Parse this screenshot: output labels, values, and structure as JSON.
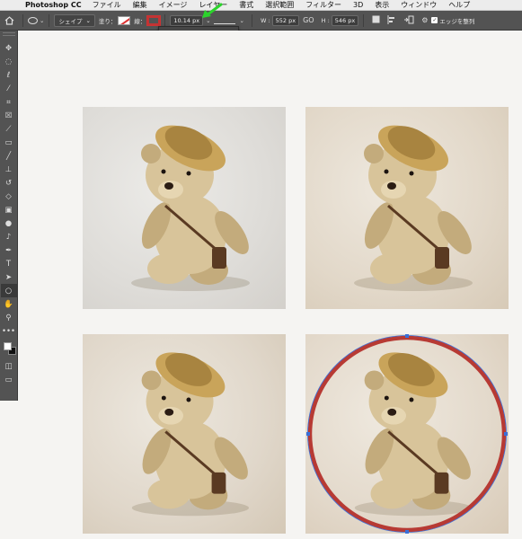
{
  "menubar": {
    "app_name": "Photoshop CC",
    "items": [
      "ファイル",
      "編集",
      "イメージ",
      "レイヤー",
      "書式",
      "選択範囲",
      "フィルター",
      "3D",
      "表示",
      "ウィンドウ",
      "ヘルプ"
    ]
  },
  "options_bar": {
    "mode": "シェイプ",
    "fill_label": "塗り：",
    "stroke_label": "線：",
    "stroke_width": "10.14 px",
    "width_label": "W :",
    "width_value": "552 px",
    "link_icon": "GO",
    "height_label": "H :",
    "height_value": "546 px",
    "align_edges_label": "エッジを整列",
    "align_edges_checked": true
  },
  "colors": {
    "toolbar_bg": "#535353",
    "stroke": "#b73a34",
    "selection": "#3a6fd8",
    "canvas_bg": "#f5f4f2",
    "arrow": "#2bd32b"
  },
  "tools": [
    "move-tool-icon",
    "marquee-ellipse-tool-icon",
    "lasso-tool-icon",
    "magic-wand-tool-icon",
    "crop-tool-icon",
    "frame-tool-icon",
    "eyedropper-tool-icon",
    "healing-brush-tool-icon",
    "brush-tool-icon",
    "stamp-tool-icon",
    "history-brush-tool-icon",
    "eraser-tool-icon",
    "gradient-tool-icon",
    "blur-tool-icon",
    "dodge-tool-icon",
    "pen-tool-icon",
    "type-tool-icon",
    "path-selection-tool-icon",
    "ellipse-tool-icon",
    "hand-tool-icon",
    "zoom-tool-icon",
    "more-tools-icon"
  ],
  "photos": [
    "teddy-bear-photo-1",
    "teddy-bear-photo-2",
    "teddy-bear-photo-3",
    "teddy-bear-photo-4"
  ]
}
